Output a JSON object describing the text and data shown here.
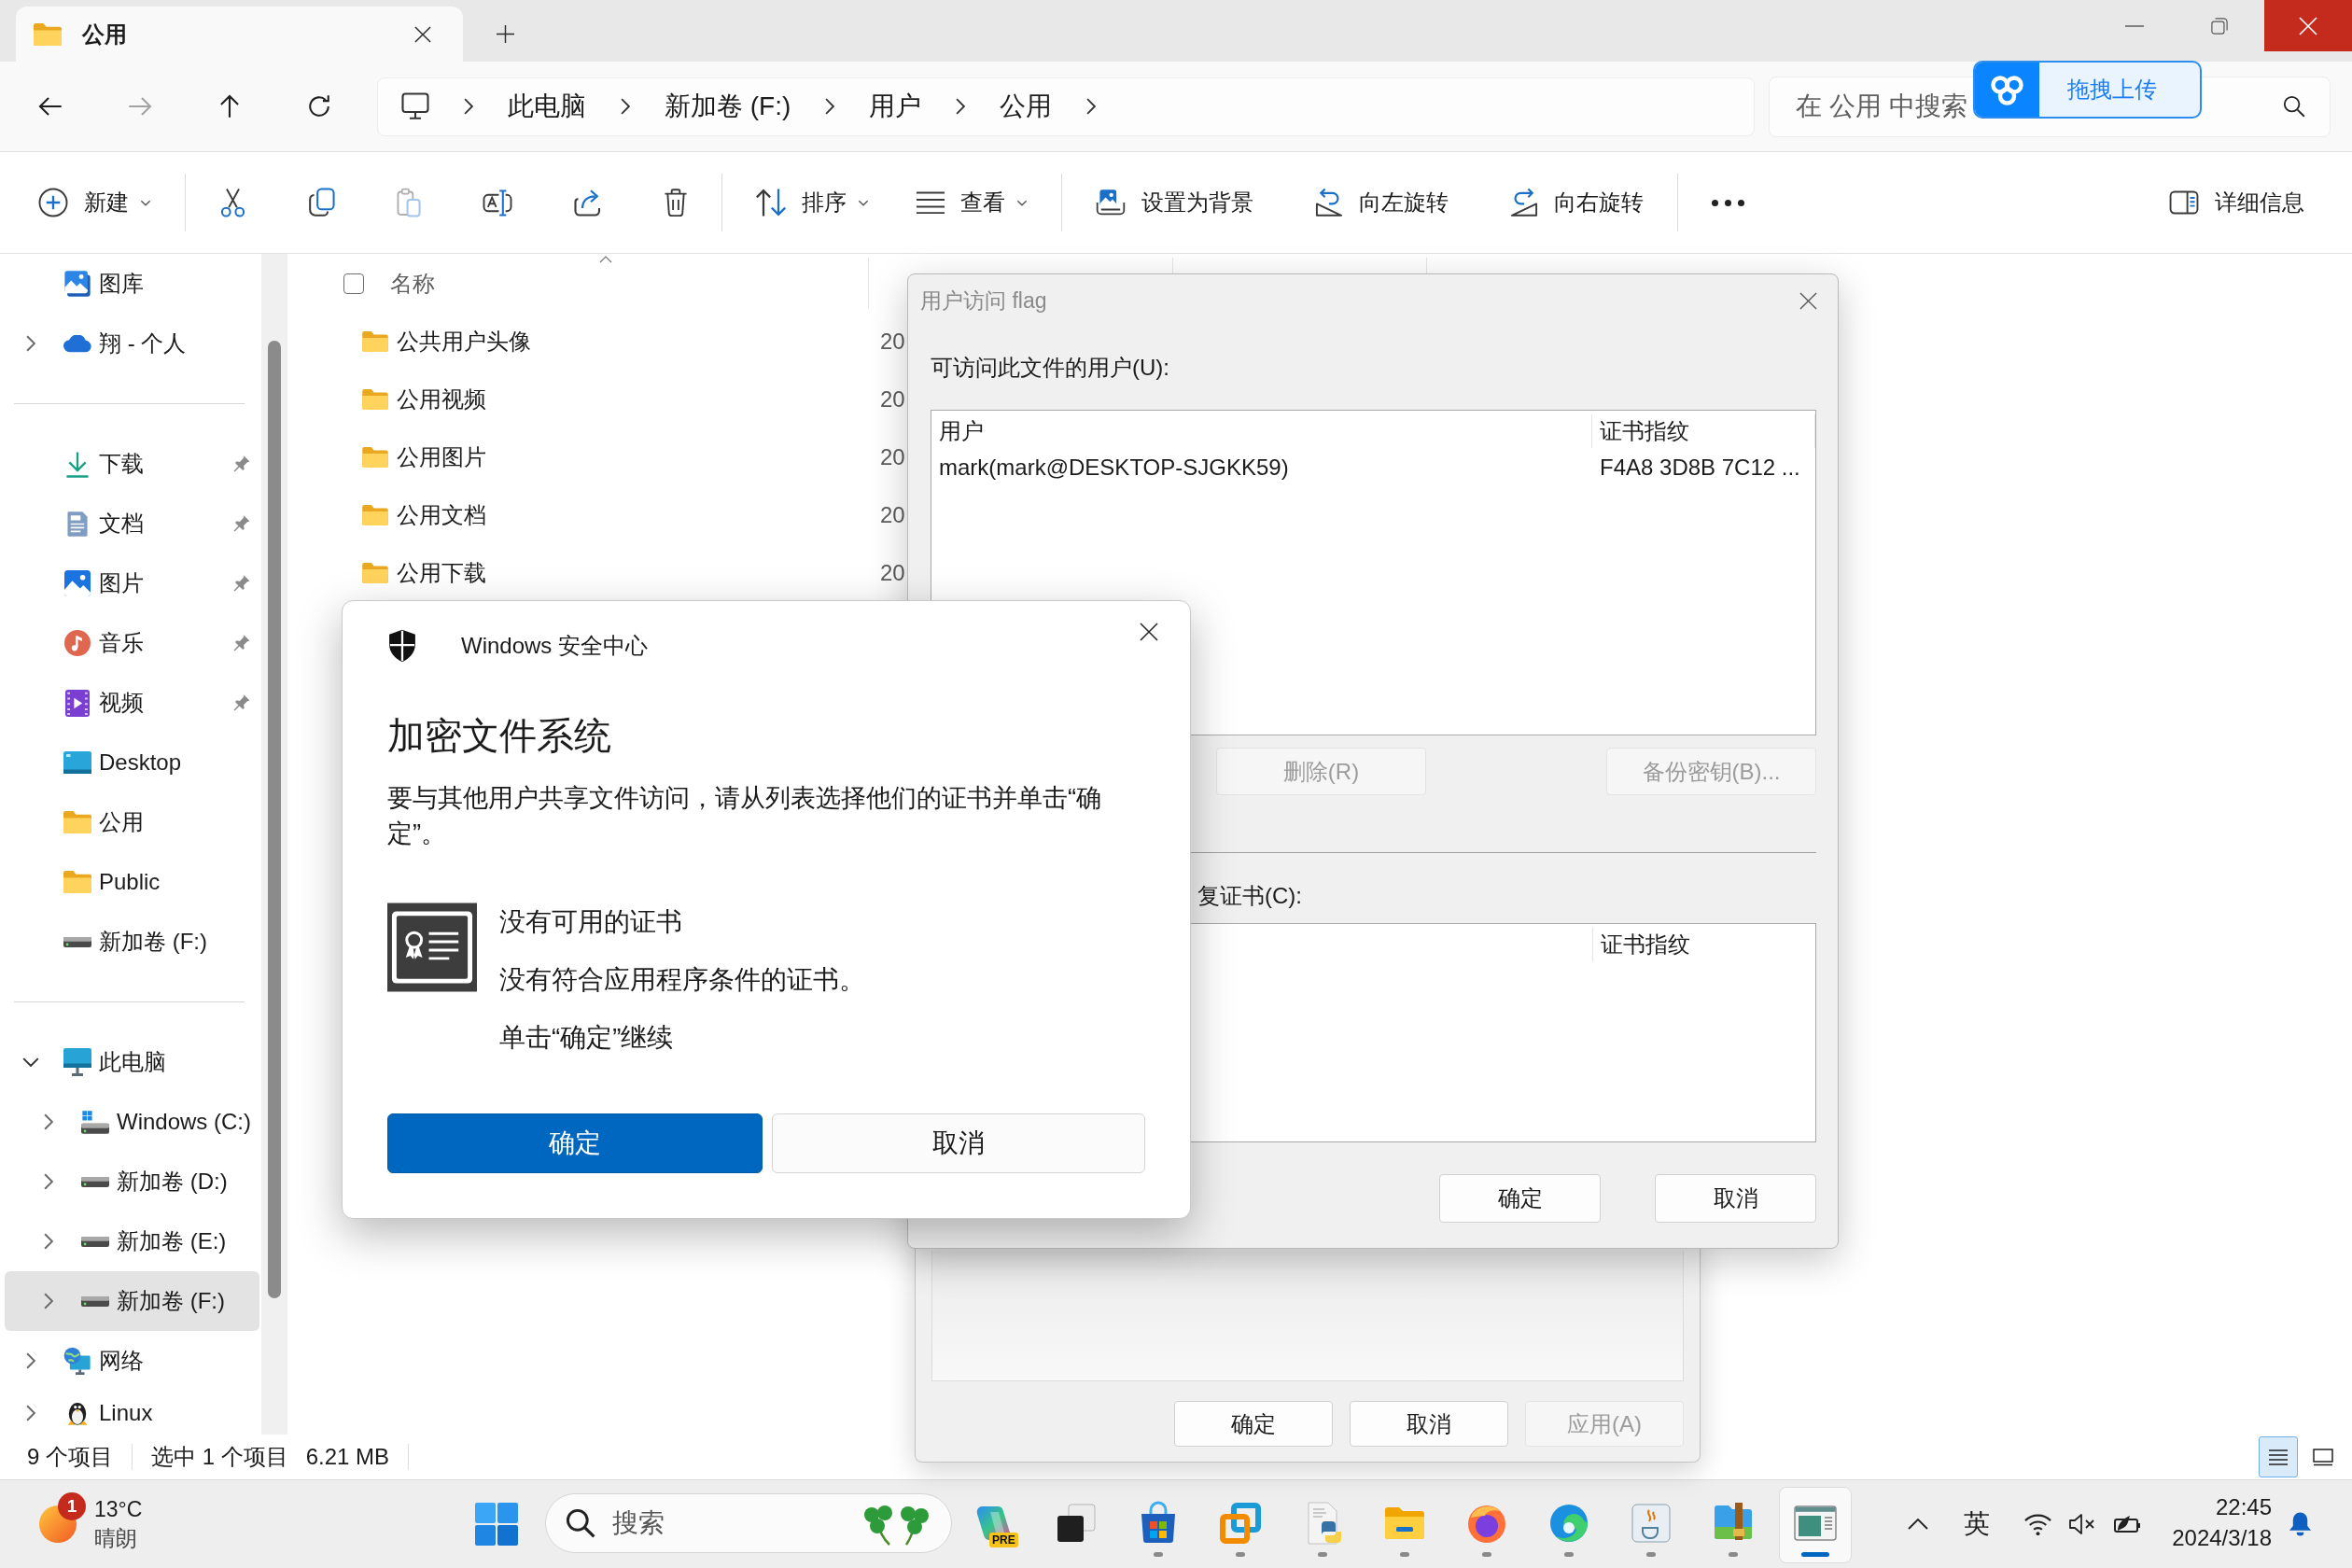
{
  "window": {
    "tab_title": "公用"
  },
  "nav_buttons": [
    {
      "disabled": false
    },
    {
      "disabled": true
    },
    {
      "disabled": false
    },
    {
      "disabled": false
    }
  ],
  "address_bar": {
    "segments": [
      "此电脑",
      "新加卷 (F:)",
      "用户",
      "公用"
    ]
  },
  "search": {
    "placeholder": "在 公用 中搜索"
  },
  "upload_widget": {
    "label": "拖拽上传"
  },
  "toolbar": {
    "groups": [
      {
        "items": [
          {
            "kind": "dropdown",
            "label": "新建",
            "disabled": false
          }
        ]
      },
      {
        "items": [
          {
            "kind": "icon",
            "disabled": false
          },
          {
            "kind": "icon",
            "disabled": false
          },
          {
            "kind": "icon",
            "disabled": true
          },
          {
            "kind": "icon",
            "disabled": false
          },
          {
            "kind": "icon",
            "disabled": false
          },
          {
            "kind": "icon",
            "disabled": false
          }
        ]
      },
      {
        "items": [
          {
            "kind": "dropdown",
            "label": "排序",
            "disabled": false
          },
          {
            "kind": "dropdown",
            "label": "查看",
            "disabled": false
          }
        ]
      },
      {
        "items": [
          {
            "kind": "button",
            "label": "设置为背景",
            "disabled": false
          },
          {
            "kind": "button",
            "label": "向左旋转",
            "disabled": false
          },
          {
            "kind": "button",
            "label": "向右旋转",
            "disabled": false
          }
        ]
      },
      {
        "items": [
          {
            "kind": "icon",
            "disabled": false
          }
        ]
      }
    ],
    "details": {
      "label": "详细信息"
    }
  },
  "sidebar": {
    "sections": [
      {
        "items": [
          {
            "label": "图库",
            "selected": false
          },
          {
            "label": "翔 - 个人",
            "selected": false,
            "expanded": false
          }
        ]
      },
      {
        "items": [
          {
            "label": "下载",
            "selected": false,
            "pinned": true
          },
          {
            "label": "文档",
            "selected": false,
            "pinned": true
          },
          {
            "label": "图片",
            "selected": false,
            "pinned": true
          },
          {
            "label": "音乐",
            "selected": false,
            "pinned": true
          },
          {
            "label": "视频",
            "selected": false,
            "pinned": true
          },
          {
            "label": "Desktop",
            "selected": false,
            "pinned": false
          },
          {
            "label": "公用",
            "selected": false,
            "pinned": false
          },
          {
            "label": "Public",
            "selected": false,
            "pinned": false
          },
          {
            "label": "新加卷 (F:)",
            "selected": false,
            "pinned": false
          }
        ]
      },
      {
        "items": [
          {
            "label": "此电脑",
            "selected": false,
            "expanded": true,
            "children": [
              {
                "label": "Windows (C:)",
                "selected": false,
                "expanded": false
              },
              {
                "label": "新加卷 (D:)",
                "selected": false,
                "expanded": false
              },
              {
                "label": "新加卷 (E:)",
                "selected": false,
                "expanded": false
              },
              {
                "label": "新加卷 (F:)",
                "selected": true,
                "expanded": false
              }
            ]
          },
          {
            "label": "网络",
            "selected": false,
            "expanded": false
          },
          {
            "label": "Linux",
            "selected": false,
            "expanded": false
          }
        ]
      }
    ]
  },
  "file_list": {
    "select_all": {
      "checked": false
    },
    "columns": [
      {
        "label": "名称",
        "sorted": true
      }
    ],
    "rows": [
      {
        "name": "公共用户头像",
        "date": "20"
      },
      {
        "name": "公用视频",
        "date": "20"
      },
      {
        "name": "公用图片",
        "date": "20"
      },
      {
        "name": "公用文档",
        "date": "20"
      },
      {
        "name": "公用下载",
        "date": "20"
      }
    ]
  },
  "status_bar": {
    "item_count": "9 个项目",
    "selection": "选中 1 个项目",
    "size": "6.21 MB",
    "view_modes": [
      {
        "selected": true
      },
      {
        "selected": false
      }
    ]
  },
  "properties_dialog": {
    "buttons": [
      {
        "label": "确定",
        "disabled": false
      },
      {
        "label": "取消",
        "disabled": false
      },
      {
        "label": "应用(A)",
        "disabled": true
      }
    ]
  },
  "efs_dialog": {
    "title": "用户访问 flag",
    "users_label": "可访问此文件的用户(U):",
    "user_columns": [
      "用户",
      "证书指纹"
    ],
    "users": [
      {
        "user": "mark(mark@DESKTOP-SJGKK59)",
        "thumbprint": "F4A8 3D8B 7C12 ..."
      }
    ],
    "buttons": [
      {
        "label": "删除(R)",
        "disabled": true
      },
      {
        "label": "备份密钥(B)...",
        "disabled": true
      }
    ],
    "recovery_label": "复证书(C):",
    "recovery_columns": [
      "证书指纹"
    ],
    "footer_buttons": [
      {
        "label": "确定",
        "disabled": false
      },
      {
        "label": "取消",
        "disabled": false
      }
    ]
  },
  "security_dialog": {
    "app_name": "Windows 安全中心",
    "title": "加密文件系统",
    "message": "要与其他用户共享文件访问，请从列表选择他们的证书并单击“确定”。",
    "certificate": {
      "title": "没有可用的证书",
      "detail": "没有符合应用程序条件的证书。",
      "hint": "单击“确定”继续"
    },
    "buttons": [
      {
        "label": "确定",
        "primary": true
      },
      {
        "label": "取消",
        "primary": false
      }
    ]
  },
  "taskbar": {
    "weather": {
      "badge": "1",
      "temperature": "13°C",
      "condition": "晴朗"
    },
    "search": {
      "placeholder": "搜索"
    },
    "apps": [
      {
        "running": false,
        "active": false,
        "badge": "PRE"
      },
      {
        "running": false,
        "active": false
      },
      {
        "running": true,
        "active": false
      },
      {
        "running": true,
        "active": false
      },
      {
        "running": true,
        "active": false
      },
      {
        "running": true,
        "active": false
      },
      {
        "running": true,
        "active": false
      },
      {
        "running": true,
        "active": false
      },
      {
        "running": true,
        "active": false
      },
      {
        "running": true,
        "active": false
      },
      {
        "running": true,
        "active": true
      }
    ],
    "input_method": "英",
    "clock": {
      "time": "22:45",
      "date": "2024/3/18"
    }
  }
}
